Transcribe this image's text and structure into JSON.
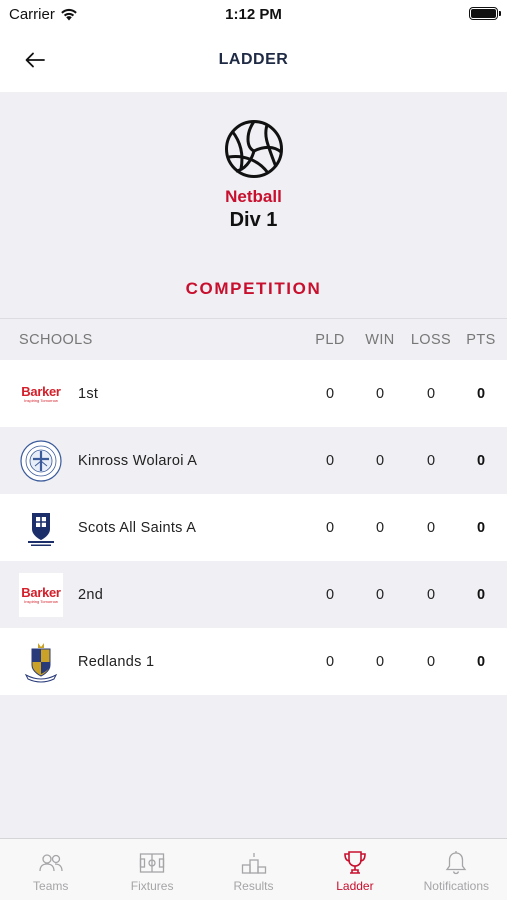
{
  "status": {
    "carrier": "Carrier",
    "time": "1:12 PM"
  },
  "nav": {
    "title": "LADDER"
  },
  "header": {
    "sport": "Netball",
    "division": "Div 1",
    "section": "COMPETITION"
  },
  "table": {
    "columns": {
      "schools": "SCHOOLS",
      "pld": "PLD",
      "win": "WIN",
      "loss": "LOSS",
      "pts": "PTS"
    },
    "rows": [
      {
        "name": "1st",
        "logo": "barker-logo",
        "pld": "0",
        "win": "0",
        "loss": "0",
        "pts": "0"
      },
      {
        "name": "Kinross Wolaroi A",
        "logo": "kinross-wolaroi-crest",
        "pld": "0",
        "win": "0",
        "loss": "0",
        "pts": "0"
      },
      {
        "name": "Scots All Saints A",
        "logo": "scots-all-saints-crest",
        "pld": "0",
        "win": "0",
        "loss": "0",
        "pts": "0"
      },
      {
        "name": "2nd",
        "logo": "barker-logo",
        "pld": "0",
        "win": "0",
        "loss": "0",
        "pts": "0"
      },
      {
        "name": "Redlands 1",
        "logo": "redlands-crest",
        "pld": "0",
        "win": "0",
        "loss": "0",
        "pts": "0"
      }
    ]
  },
  "barker_logo": {
    "word": "Barker",
    "tagline": "Inspiring Tomorrow"
  },
  "tabs": [
    {
      "label": "Teams",
      "icon": "people-icon"
    },
    {
      "label": "Fixtures",
      "icon": "field-icon"
    },
    {
      "label": "Results",
      "icon": "podium-icon"
    },
    {
      "label": "Ladder",
      "icon": "trophy-icon",
      "active": true
    },
    {
      "label": "Notifications",
      "icon": "bell-icon"
    }
  ],
  "colors": {
    "accent": "#c8102e",
    "title": "#1f2a44",
    "inactive_tab": "#a5a5a8"
  }
}
